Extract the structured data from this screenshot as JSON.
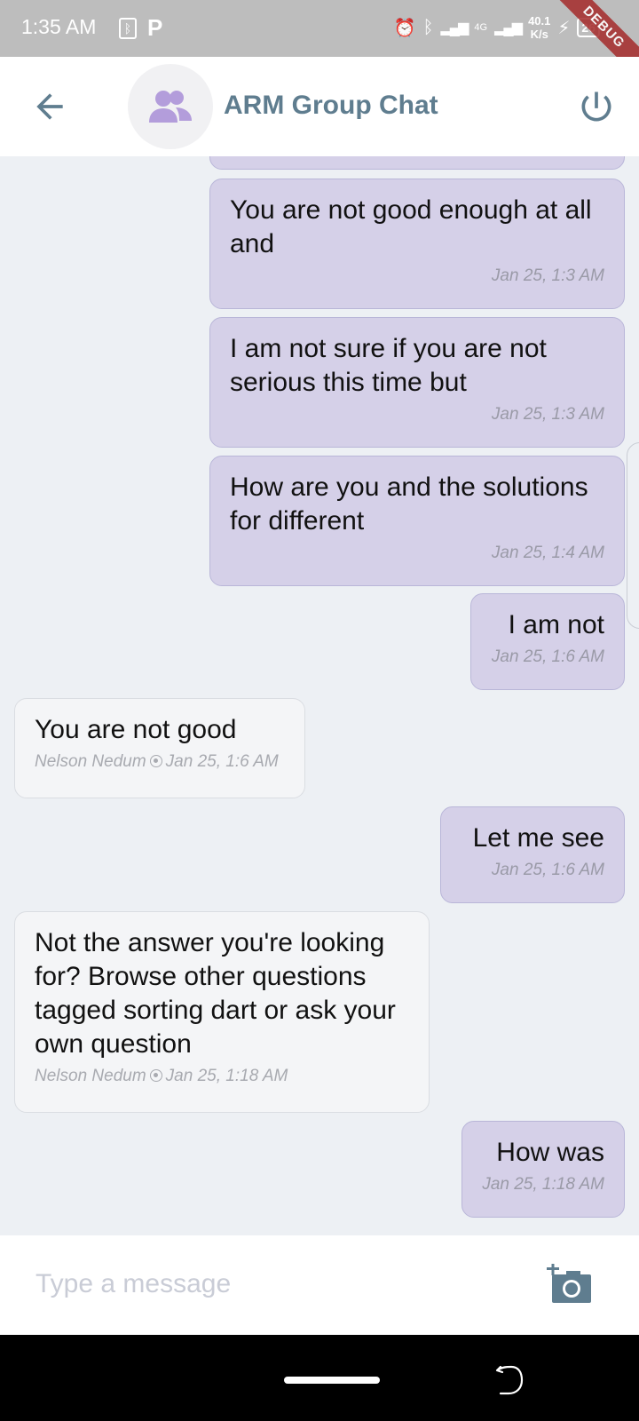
{
  "status_bar": {
    "time": "1:35 AM",
    "network_speed_value": "40.1",
    "network_speed_unit": "K/s",
    "network_type": "4G",
    "battery": "26",
    "debug_label": "DEBUG"
  },
  "header": {
    "title": "ARM Group Chat"
  },
  "messages": [
    {
      "direction": "out",
      "text": "",
      "time": ""
    },
    {
      "direction": "out",
      "text": "You are not good enough at all and",
      "time": "Jan 25, 1:3 AM"
    },
    {
      "direction": "out",
      "text": "I am not sure if you are not serious this time but",
      "time": "Jan 25, 1:3 AM"
    },
    {
      "direction": "out",
      "text": "How are you and the solutions for different",
      "time": "Jan 25, 1:4 AM"
    },
    {
      "direction": "out",
      "text": "I am not",
      "time": "Jan 25, 1:6 AM"
    },
    {
      "direction": "in",
      "text": "You are not good",
      "sender": "Nelson Nedum",
      "time": "Jan 25, 1:6 AM"
    },
    {
      "direction": "out",
      "text": "Let me see",
      "time": "Jan 25, 1:6 AM"
    },
    {
      "direction": "in",
      "text": "Not the answer you're looking for? Browse other questions tagged sorting dart or ask your own question",
      "sender": "Nelson Nedum",
      "time": "Jan 25, 1:18 AM"
    },
    {
      "direction": "out",
      "text": "How was",
      "time": "Jan 25, 1:18 AM"
    }
  ],
  "composer": {
    "placeholder": "Type a message"
  },
  "colors": {
    "outgoing_bubble": "#d5d0e8",
    "incoming_bubble": "#f4f5f7",
    "chat_background": "#edf0f4",
    "accent": "#5f7d8f",
    "avatar_icon": "#b39ddb"
  },
  "icons": {
    "back": "arrow-left-icon",
    "group_avatar": "group-icon",
    "logout": "power-icon",
    "attach_photo": "add-camera-icon"
  }
}
